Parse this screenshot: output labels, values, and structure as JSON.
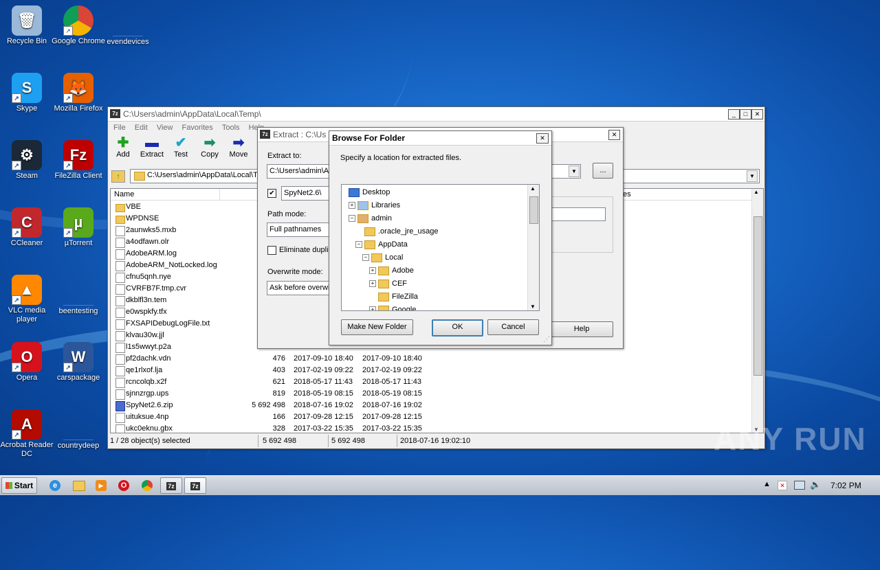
{
  "desktop": {
    "icons": [
      {
        "label": "Recycle Bin"
      },
      {
        "label": "Google Chrome"
      },
      {
        "label": "evendevices"
      },
      {
        "label": "Skype"
      },
      {
        "label": "Mozilla Firefox"
      },
      {
        "label": "Steam"
      },
      {
        "label": "FileZilla Client"
      },
      {
        "label": "CCleaner"
      },
      {
        "label": "µTorrent"
      },
      {
        "label": "VLC media player"
      },
      {
        "label": "beentesting"
      },
      {
        "label": "Opera"
      },
      {
        "label": "carspackage"
      },
      {
        "label": "Acrobat Reader DC"
      },
      {
        "label": "countrydeep"
      }
    ]
  },
  "filemanager": {
    "title": "C:\\Users\\admin\\AppData\\Local\\Temp\\",
    "app_icon": "7z",
    "menu": [
      "File",
      "Edit",
      "View",
      "Favorites",
      "Tools",
      "Help"
    ],
    "toolbar": [
      {
        "label": "Add",
        "glyph": "✚",
        "color": "#1ea320"
      },
      {
        "label": "Extract",
        "glyph": "▬",
        "color": "#1b2bb0"
      },
      {
        "label": "Test",
        "glyph": "✔",
        "color": "#19a7c8"
      },
      {
        "label": "Copy",
        "glyph": "➡",
        "color": "#1b8e6b"
      },
      {
        "label": "Move",
        "glyph": "➡",
        "color": "#1b2bb0"
      }
    ],
    "address": "C:\\Users\\admin\\AppData\\Local\\Te",
    "header_name": "Name",
    "header_tail": "es",
    "files": [
      {
        "name": "VBE",
        "type": "folder",
        "size": "",
        "modified": "",
        "created": ""
      },
      {
        "name": "WPDNSE",
        "type": "folder",
        "size": "",
        "modified": "",
        "created": ""
      },
      {
        "name": "2aunwks5.mxb",
        "type": "file",
        "size": "",
        "modified": "",
        "created": ""
      },
      {
        "name": "a4odfawn.olr",
        "type": "file",
        "size": "",
        "modified": "",
        "created": ""
      },
      {
        "name": "AdobeARM.log",
        "type": "file",
        "size": "",
        "modified": "",
        "created": ""
      },
      {
        "name": "AdobeARM_NotLocked.log",
        "type": "file",
        "size": "",
        "modified": "",
        "created": ""
      },
      {
        "name": "cfnu5qnh.nye",
        "type": "file",
        "size": "",
        "modified": "",
        "created": ""
      },
      {
        "name": "CVRFB7F.tmp.cvr",
        "type": "file",
        "size": "",
        "modified": "",
        "created": ""
      },
      {
        "name": "dkblfl3n.tem",
        "type": "file",
        "size": "",
        "modified": "",
        "created": ""
      },
      {
        "name": "e0wspkfy.tfx",
        "type": "file",
        "size": "",
        "modified": "",
        "created": ""
      },
      {
        "name": "FXSAPIDebugLogFile.txt",
        "type": "file",
        "size": "",
        "modified": "",
        "created": ""
      },
      {
        "name": "klvau30w.jjl",
        "type": "file",
        "size": "",
        "modified": "",
        "created": ""
      },
      {
        "name": "l1s5wwyt.p2a",
        "type": "file",
        "size": "",
        "modified": "",
        "created": ""
      },
      {
        "name": "pf2dachk.vdn",
        "type": "file",
        "size": "476",
        "modified": "2017-09-10 18:40",
        "created": "2017-09-10 18:40"
      },
      {
        "name": "qe1rlxof.lja",
        "type": "file",
        "size": "403",
        "modified": "2017-02-19 09:22",
        "created": "2017-02-19 09:22"
      },
      {
        "name": "rcncolqb.x2f",
        "type": "file",
        "size": "621",
        "modified": "2018-05-17 11:43",
        "created": "2018-05-17 11:43"
      },
      {
        "name": "sjnnzrgp.ups",
        "type": "file",
        "size": "819",
        "modified": "2018-05-19 08:15",
        "created": "2018-05-19 08:15"
      },
      {
        "name": "SpyNet2.6.zip",
        "type": "zip",
        "size": "5 692 498",
        "modified": "2018-07-16 19:02",
        "created": "2018-07-16 19:02"
      },
      {
        "name": "uituksue.4np",
        "type": "file",
        "size": "166",
        "modified": "2017-09-28 12:15",
        "created": "2017-09-28 12:15"
      },
      {
        "name": "ukc0eknu.gbx",
        "type": "file",
        "size": "328",
        "modified": "2017-03-22 15:35",
        "created": "2017-03-22 15:35"
      }
    ],
    "status": {
      "selected": "1 / 28 object(s) selected",
      "size1": "5 692 498",
      "size2": "5 692 498",
      "date": "2018-07-16 19:02:10"
    }
  },
  "extract": {
    "title": "Extract : C:\\Us",
    "extract_to_label": "Extract to:",
    "extract_to_value": "C:\\Users\\admin\\A",
    "browse_label": "...",
    "subfolder_value": "SpyNet2.6\\",
    "path_mode_label": "Path mode:",
    "path_mode_value": "Full pathnames",
    "eliminate_label": "Eliminate duplic",
    "overwrite_label": "Overwrite mode:",
    "overwrite_value": "Ask before overwi",
    "help_label": "Help"
  },
  "browse": {
    "title": "Browse For Folder",
    "close": "✕",
    "instruction": "Specify a location for extracted files.",
    "tree": [
      {
        "label": "Desktop",
        "level": 0,
        "expander": "",
        "icon": "desktop"
      },
      {
        "label": "Libraries",
        "level": 1,
        "expander": "+",
        "icon": "lib"
      },
      {
        "label": "admin",
        "level": 1,
        "expander": "−",
        "icon": "user"
      },
      {
        "label": ".oracle_jre_usage",
        "level": 2,
        "expander": "",
        "icon": "folder"
      },
      {
        "label": "AppData",
        "level": 2,
        "expander": "−",
        "icon": "folder"
      },
      {
        "label": "Local",
        "level": 3,
        "expander": "−",
        "icon": "folder"
      },
      {
        "label": "Adobe",
        "level": 4,
        "expander": "+",
        "icon": "folder"
      },
      {
        "label": "CEF",
        "level": 4,
        "expander": "+",
        "icon": "folder"
      },
      {
        "label": "FileZilla",
        "level": 4,
        "expander": "",
        "icon": "folder"
      },
      {
        "label": "Google",
        "level": 4,
        "expander": "+",
        "icon": "folder"
      }
    ],
    "make_folder": "Make New Folder",
    "ok": "OK",
    "cancel": "Cancel"
  },
  "taskbar": {
    "start": "Start",
    "clock": "7:02 PM",
    "tasks": [
      "7z",
      "7z"
    ]
  },
  "watermark": "ANY RUN"
}
